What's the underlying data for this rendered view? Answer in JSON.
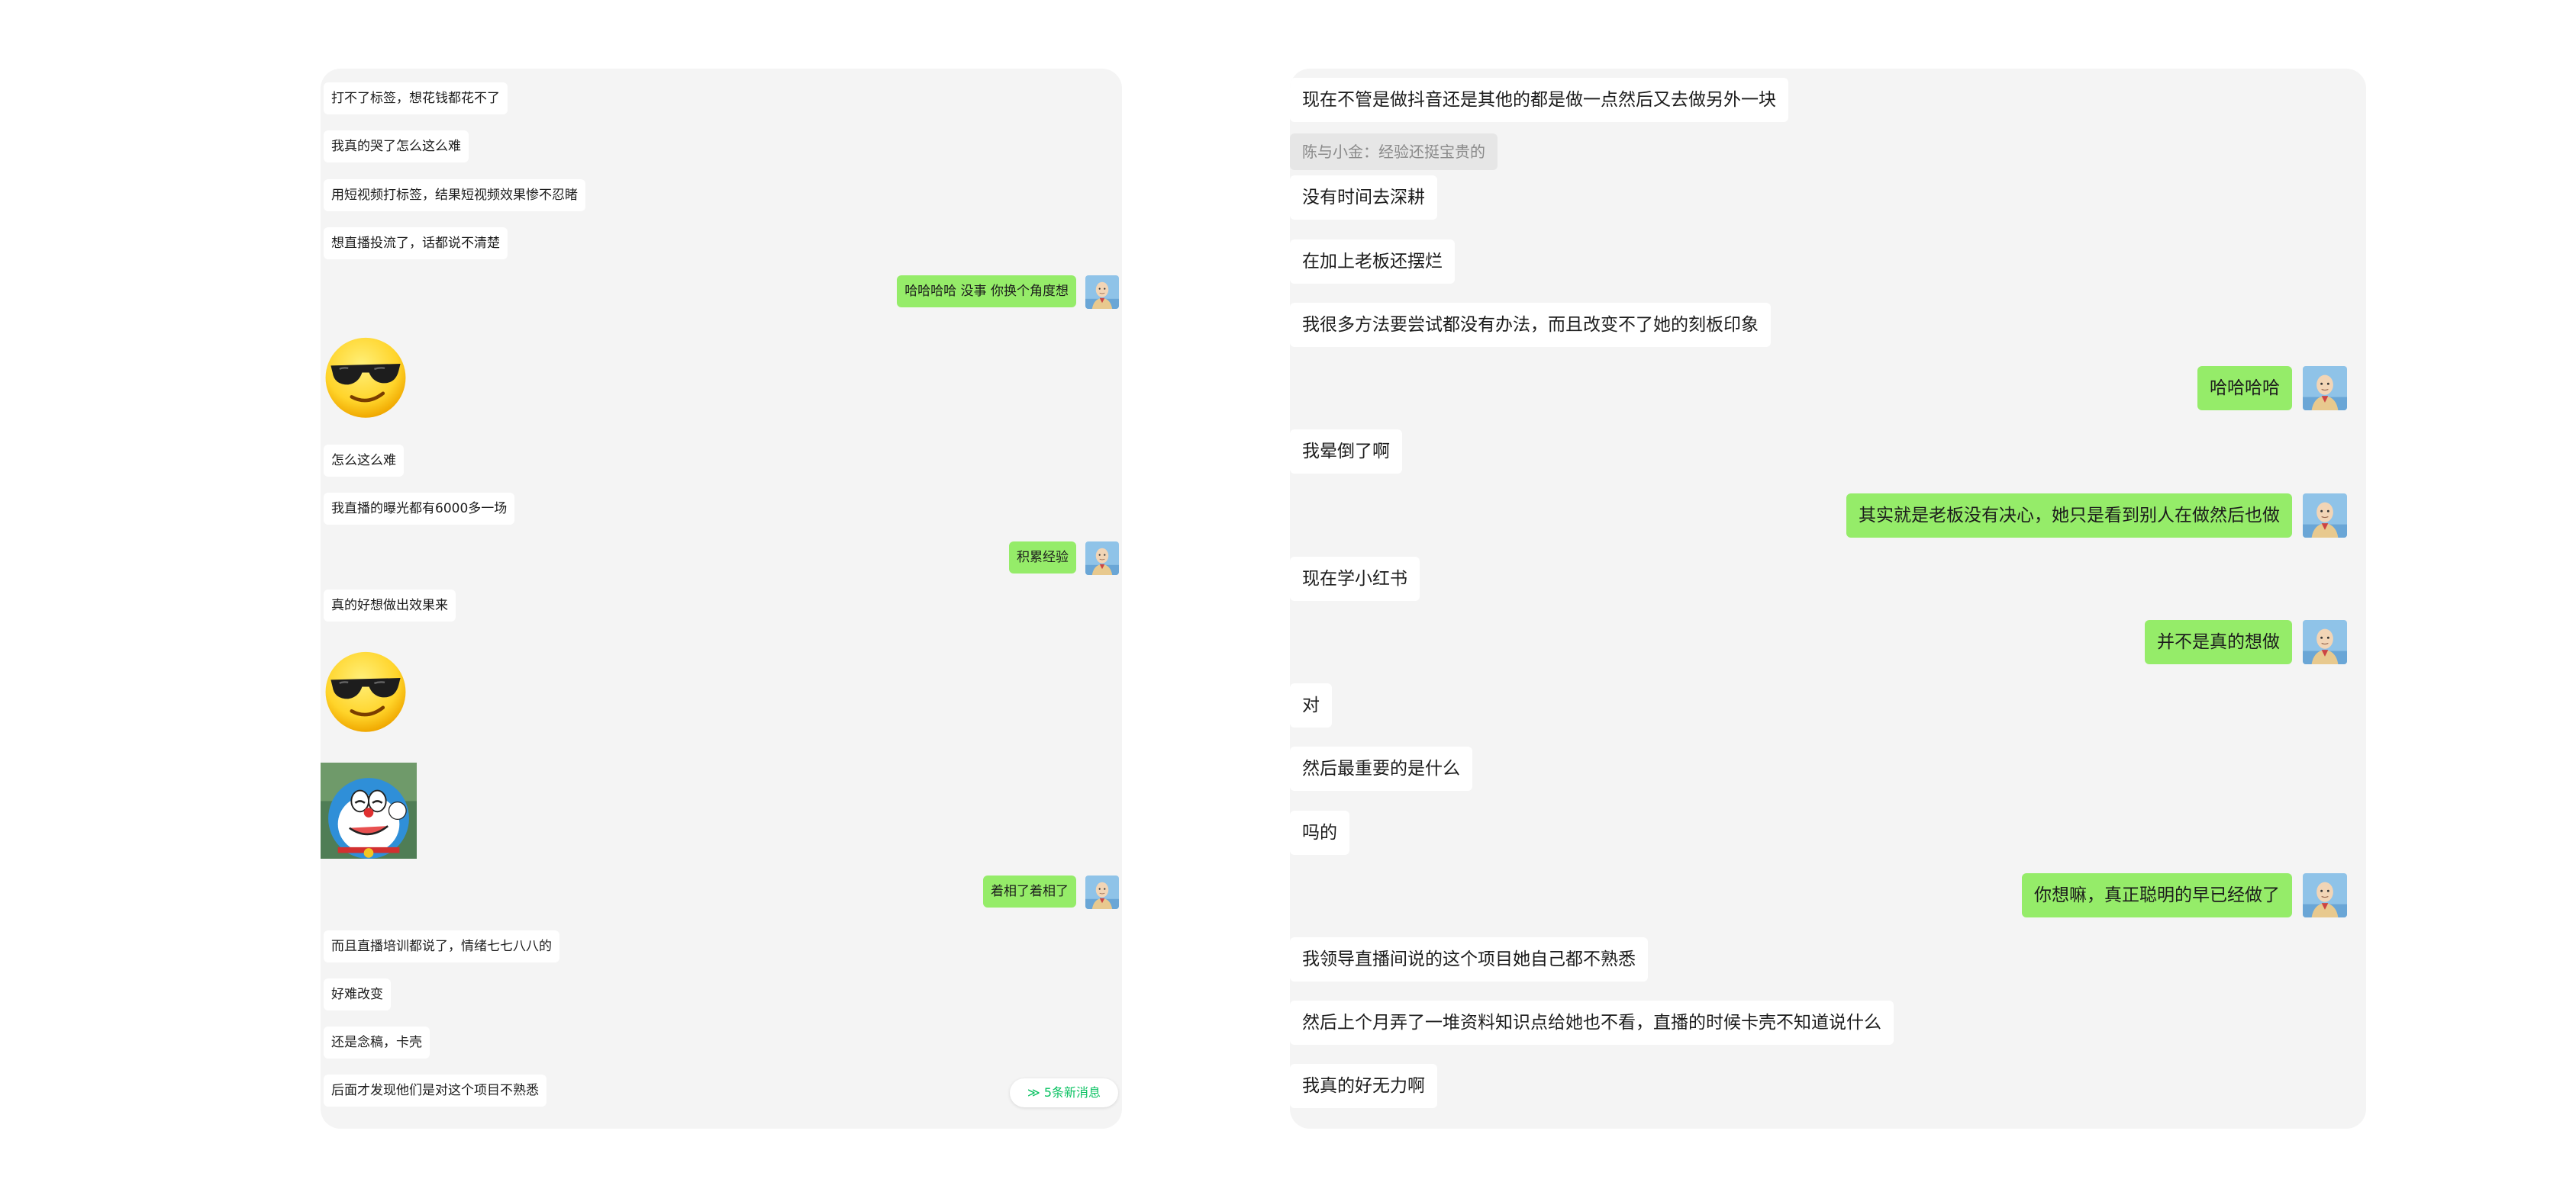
{
  "colors": {
    "panel_bg": "#f4f4f4",
    "own_bubble": "#95ec69",
    "other_bubble": "#ffffff",
    "badge_text": "#07c160",
    "quote_bg": "#e6e6e6"
  },
  "left_chat": {
    "messages": [
      {
        "side": "other",
        "type": "text",
        "text": "打不了标签，想花钱都花不了"
      },
      {
        "side": "other",
        "type": "text",
        "text": "我真的哭了怎么这么难"
      },
      {
        "side": "other",
        "type": "text",
        "text": "用短视频打标签，结果短视频效果惨不忍睹"
      },
      {
        "side": "other",
        "type": "text",
        "text": "想直播投流了，话都说不清楚"
      },
      {
        "side": "self",
        "type": "text",
        "text": "哈哈哈哈  没事 你换个角度想"
      },
      {
        "side": "other",
        "type": "sticker",
        "icon": "sunglasses-emoji-icon"
      },
      {
        "side": "other",
        "type": "text",
        "text": "怎么这么难"
      },
      {
        "side": "other",
        "type": "text",
        "text": "我直播的曝光都有6000多一场"
      },
      {
        "side": "self",
        "type": "text",
        "text": "积累经验"
      },
      {
        "side": "other",
        "type": "text",
        "text": "真的好想做出效果来"
      },
      {
        "side": "other",
        "type": "sticker",
        "icon": "sunglasses-emoji-icon"
      },
      {
        "side": "other",
        "type": "sticker",
        "icon": "doraemon-sticker-icon"
      },
      {
        "side": "self",
        "type": "text",
        "text": "着相了着相了"
      },
      {
        "side": "other",
        "type": "text",
        "text": "而且直播培训都说了，情绪七七八八的"
      },
      {
        "side": "other",
        "type": "text",
        "text": "好难改变"
      },
      {
        "side": "other",
        "type": "text",
        "text": "还是念稿，卡壳"
      },
      {
        "side": "other",
        "type": "text",
        "text": "后面才发现他们是对这个项目不熟悉"
      }
    ],
    "new_messages_badge": "≫ 5条新消息"
  },
  "right_chat": {
    "messages": [
      {
        "side": "other",
        "type": "text",
        "text": "现在不管是做抖音还是其他的都是做一点然后又去做另外一块"
      },
      {
        "side": "other",
        "type": "quote",
        "text": "陈与小金：经验还挺宝贵的"
      },
      {
        "side": "other",
        "type": "text",
        "text": "没有时间去深耕"
      },
      {
        "side": "other",
        "type": "text",
        "text": "在加上老板还摆烂"
      },
      {
        "side": "other",
        "type": "text",
        "text": "我很多方法要尝试都没有办法，而且改变不了她的刻板印象"
      },
      {
        "side": "self",
        "type": "text",
        "text": "哈哈哈哈"
      },
      {
        "side": "other",
        "type": "text",
        "text": "我晕倒了啊"
      },
      {
        "side": "self",
        "type": "text",
        "text": "其实就是老板没有决心，她只是看到别人在做然后也做"
      },
      {
        "side": "other",
        "type": "text",
        "text": "现在学小红书"
      },
      {
        "side": "self",
        "type": "text",
        "text": "并不是真的想做"
      },
      {
        "side": "other",
        "type": "text",
        "text": "对"
      },
      {
        "side": "other",
        "type": "text",
        "text": "然后最重要的是什么"
      },
      {
        "side": "other",
        "type": "text",
        "text": "吗的"
      },
      {
        "side": "self",
        "type": "text",
        "text": "你想嘛，真正聪明的早已经做了"
      },
      {
        "side": "other",
        "type": "text",
        "text": "我领导直播间说的这个项目她自己都不熟悉"
      },
      {
        "side": "other",
        "type": "text",
        "text": "然后上个月弄了一堆资料知识点给她也不看，直播的时候卡壳不知道说什么"
      },
      {
        "side": "other",
        "type": "text",
        "text": "我真的好无力啊"
      }
    ]
  }
}
